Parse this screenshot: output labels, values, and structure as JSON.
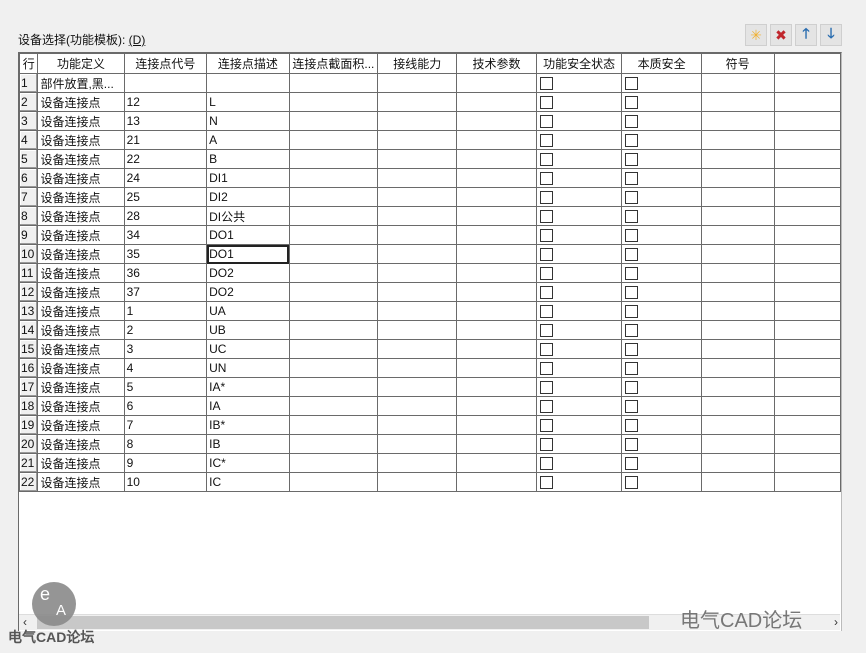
{
  "label": {
    "text": "设备选择(功能模板): ",
    "mnemonic": "(D)"
  },
  "toolbar": [
    {
      "name": "new-icon",
      "glyph": "✳",
      "color": "#f0b030"
    },
    {
      "name": "delete-icon",
      "glyph": "✖",
      "color": "#c0262c"
    },
    {
      "name": "move-up-icon",
      "glyph": "🡑",
      "color": "#2a6db0"
    },
    {
      "name": "move-down-icon",
      "glyph": "🡓",
      "color": "#2a6db0"
    }
  ],
  "columns": [
    "行",
    "功能定义",
    "连接点代号",
    "连接点描述",
    "连接点截面积...",
    "接线能力",
    "技术参数",
    "功能安全状态",
    "本质安全",
    "符号"
  ],
  "rows": [
    {
      "n": "1",
      "func": "部件放置,黑...",
      "code": "",
      "desc": ""
    },
    {
      "n": "2",
      "func": "设备连接点",
      "code": "12",
      "desc": "L"
    },
    {
      "n": "3",
      "func": "设备连接点",
      "code": "13",
      "desc": "N"
    },
    {
      "n": "4",
      "func": "设备连接点",
      "code": "21",
      "desc": "A"
    },
    {
      "n": "5",
      "func": "设备连接点",
      "code": "22",
      "desc": "B"
    },
    {
      "n": "6",
      "func": "设备连接点",
      "code": "24",
      "desc": "DI1"
    },
    {
      "n": "7",
      "func": "设备连接点",
      "code": "25",
      "desc": "DI2"
    },
    {
      "n": "8",
      "func": "设备连接点",
      "code": "28",
      "desc": "DI公共"
    },
    {
      "n": "9",
      "func": "设备连接点",
      "code": "34",
      "desc": "DO1"
    },
    {
      "n": "10",
      "func": "设备连接点",
      "code": "35",
      "desc": "DO1",
      "selected": true
    },
    {
      "n": "11",
      "func": "设备连接点",
      "code": "36",
      "desc": "DO2"
    },
    {
      "n": "12",
      "func": "设备连接点",
      "code": "37",
      "desc": "DO2"
    },
    {
      "n": "13",
      "func": "设备连接点",
      "code": "1",
      "desc": "UA"
    },
    {
      "n": "14",
      "func": "设备连接点",
      "code": "2",
      "desc": "UB"
    },
    {
      "n": "15",
      "func": "设备连接点",
      "code": "3",
      "desc": "UC"
    },
    {
      "n": "16",
      "func": "设备连接点",
      "code": "4",
      "desc": "UN"
    },
    {
      "n": "17",
      "func": "设备连接点",
      "code": "5",
      "desc": "IA*"
    },
    {
      "n": "18",
      "func": "设备连接点",
      "code": "6",
      "desc": "IA"
    },
    {
      "n": "19",
      "func": "设备连接点",
      "code": "7",
      "desc": "IB*"
    },
    {
      "n": "20",
      "func": "设备连接点",
      "code": "8",
      "desc": "IB"
    },
    {
      "n": "21",
      "func": "设备连接点",
      "code": "9",
      "desc": "IC*"
    },
    {
      "n": "22",
      "func": "设备连接点",
      "code": "10",
      "desc": "IC"
    }
  ],
  "scroll": {
    "left": "‹",
    "right": "›"
  },
  "watermark": {
    "logo_top": "e",
    "logo_bottom": "A",
    "text": "电气CAD论坛",
    "right_text": "电气CAD论坛"
  }
}
